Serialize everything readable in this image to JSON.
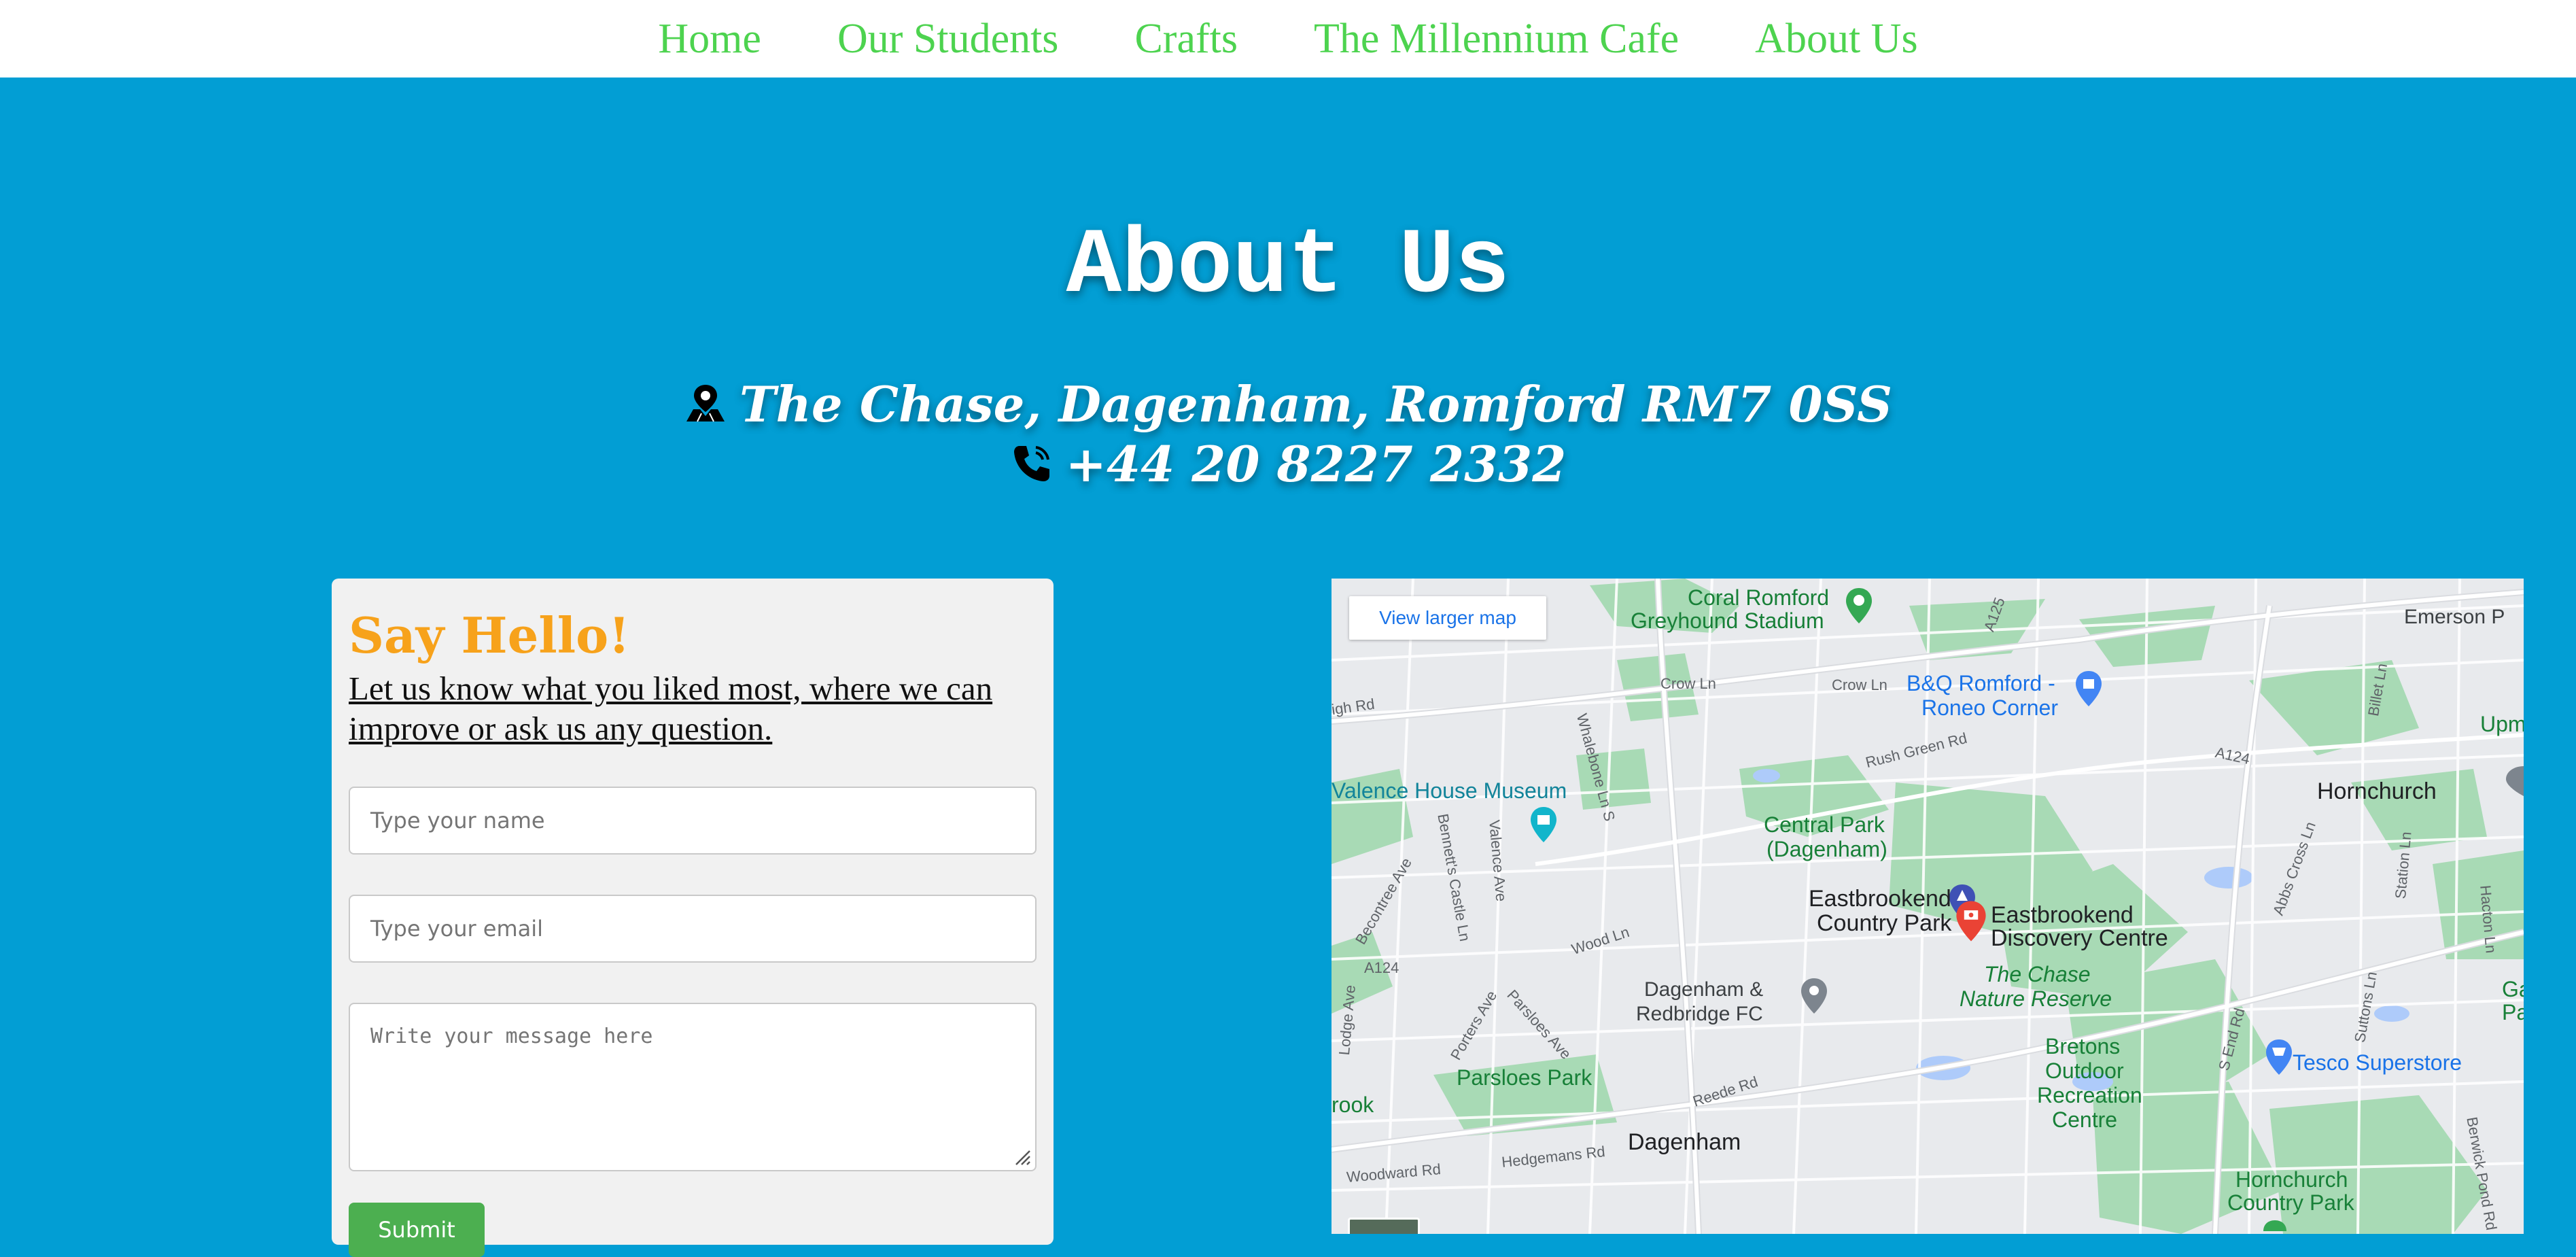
{
  "nav": {
    "items": [
      "Home",
      "Our Students",
      "Crafts",
      "The Millennium Cafe",
      "About Us"
    ]
  },
  "page": {
    "title": "About Us",
    "address": "The Chase, Dagenham, Romford RM7 0SS",
    "phone": "+44 20 8227 2332"
  },
  "form": {
    "heading": "Say Hello!",
    "subheading": "Let us know what you liked most, where we can improve or ask us any question.",
    "name_placeholder": "Type your name",
    "email_placeholder": "Type your email",
    "message_placeholder": "Write your message here",
    "submit_label": "Submit"
  },
  "map": {
    "view_larger": "View larger map",
    "labels": {
      "coral_romford": "Coral Romford",
      "greyhound": "Greyhound Stadium",
      "a125": "A125",
      "emerson": "Emerson P",
      "high_rd": "igh Rd",
      "crow_ln_1": "Crow Ln",
      "crow_ln_2": "Crow Ln",
      "whalebone": "Whalebone Ln S",
      "bq": "B&Q Romford -",
      "roneo": "Roneo Corner",
      "upmins": "Upmins",
      "rush_green": "Rush Green Rd",
      "a124_r": "A124",
      "billet": "Billet Ln",
      "valence_museum": "Valence House Museum",
      "hornchurch": "Hornchurch",
      "central_park_1": "Central Park",
      "central_park_2": "(Dagenham)",
      "bennetts": "Bennett's Castle Ln",
      "valence_ave": "Valence Ave",
      "becontree": "Becontree Ave",
      "eastbrookend_1": "Eastbrookend",
      "eastbrookend_2": "Country Park",
      "discovery_1": "Eastbrookend",
      "discovery_2": "Discovery Centre",
      "abbs": "Abbs Cross Ln",
      "station_ln": "Station Ln",
      "hacton": "Hacton Ln",
      "wood_ln": "Wood Ln",
      "a124_l": "A124",
      "chase_1": "The Chase",
      "chase_2": "Nature Reserve",
      "dag_fc_1": "Dagenham &",
      "dag_fc_2": "Redbridge FC",
      "lodge": "Lodge Ave",
      "porters": "Porters Ave",
      "parsloes_ave": "Parsloes Ave",
      "gayn_1": "Gayn",
      "gayn_2": "Parkv",
      "bretons_1": "Bretons",
      "bretons_2": "Outdoor",
      "bretons_3": "Recreation",
      "bretons_4": "Centre",
      "s_end": "S End Rd",
      "suttons": "Suttons Ln",
      "tesco": "Tesco Superstore",
      "parsloes_park": "Parsloes Park",
      "reede": "Reede Rd",
      "brook": "rook",
      "dagenham": "Dagenham",
      "hedgemans": "Hedgemans Rd",
      "woodward": "Woodward Rd",
      "hornchurch_cp_1": "Hornchurch",
      "hornchurch_cp_2": "Country Park",
      "berwick": "Berwick Pond Rd"
    }
  },
  "colors": {
    "background": "#029ed4",
    "nav_link": "#4dd34f",
    "hello": "#f7a21b",
    "submit": "#4caf50"
  }
}
